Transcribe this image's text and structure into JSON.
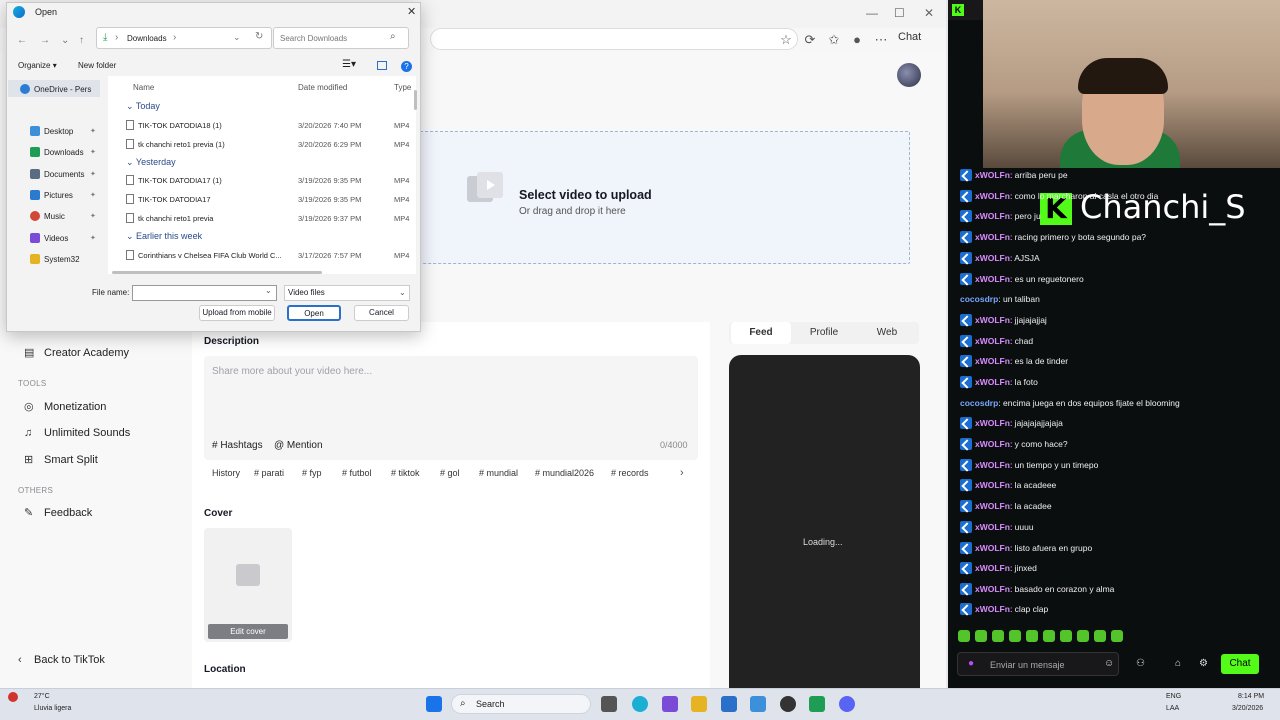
{
  "browser": {
    "win_controls": [
      "—",
      "☐",
      "✕"
    ],
    "chat_label": "Chat",
    "icons": [
      "star-icon",
      "reading-icon",
      "favorites-icon",
      "profile-icon",
      "more-icon"
    ]
  },
  "dialog": {
    "title": "Open",
    "breadcrumb": "Downloads",
    "search_placeholder": "Search Downloads",
    "organize": "Organize",
    "new_folder": "New folder",
    "nav_items": [
      {
        "label": "OneDrive - Pers",
        "color": "#2b7cd3"
      },
      {
        "label": "Desktop",
        "color": "#3c8fd9"
      },
      {
        "label": "Downloads",
        "color": "#1f9d55"
      },
      {
        "label": "Documents",
        "color": "#5a6b84"
      },
      {
        "label": "Pictures",
        "color": "#2a7bd0"
      },
      {
        "label": "Music",
        "color": "#d14836"
      },
      {
        "label": "Videos",
        "color": "#7b4ad6"
      },
      {
        "label": "System32",
        "color": "#e6b422"
      }
    ],
    "columns": {
      "name": "Name",
      "date": "Date modified",
      "type": "Type"
    },
    "groups": [
      {
        "label": "Today",
        "files": [
          {
            "name": "TIK-TOK DATODIA18 (1)",
            "date": "3/20/2026 7:40 PM",
            "type": "MP4"
          },
          {
            "name": "tk chanchi reto1 previa (1)",
            "date": "3/20/2026 6:29 PM",
            "type": "MP4"
          }
        ]
      },
      {
        "label": "Yesterday",
        "files": [
          {
            "name": "TIK-TOK DATODIA17 (1)",
            "date": "3/19/2026 9:35 PM",
            "type": "MP4"
          },
          {
            "name": "TIK-TOK DATODIA17",
            "date": "3/19/2026 9:35 PM",
            "type": "MP4"
          },
          {
            "name": "tk chanchi reto1 previa",
            "date": "3/19/2026 9:37 PM",
            "type": "MP4"
          }
        ]
      },
      {
        "label": "Earlier this week",
        "files": [
          {
            "name": "Corinthians v Chelsea  FIFA Club World C...",
            "date": "3/17/2026 7:57 PM",
            "type": "MP4"
          }
        ]
      }
    ],
    "file_name_label": "File name:",
    "file_name_value": "",
    "file_type": "Video files",
    "upload_mobile": "Upload from mobile",
    "open": "Open",
    "cancel": "Cancel"
  },
  "tiktok": {
    "upload_title": "Select video to upload",
    "upload_sub": "Or drag and drop it here",
    "sidebar": {
      "creator_academy": "Creator Academy",
      "tools_head": "TOOLS",
      "tools": [
        "Monetization",
        "Unlimited Sounds",
        "Smart Split"
      ],
      "others_head": "OTHERS",
      "feedback": "Feedback",
      "back": "Back to TikTok"
    },
    "description_label": "Description",
    "description_placeholder": "Share more about your video here...",
    "hashtags": "# Hashtags",
    "mention": "@ Mention",
    "char_count": "0/4000",
    "history": "History",
    "tags": [
      "# parati",
      "# fyp",
      "# futbol",
      "# tiktok",
      "# gol",
      "# mundial",
      "# mundial2026",
      "# records"
    ],
    "cover_label": "Cover",
    "edit_cover": "Edit cover",
    "location_label": "Location",
    "preview_tabs": [
      "Feed",
      "Profile",
      "Web"
    ],
    "loading": "Loading..."
  },
  "kick": {
    "streamer_overlay": "Chanchi_S",
    "messages": [
      {
        "user": "xWOLFn",
        "color": "#d98cff",
        "badge": true,
        "text": ": arriba peru pe"
      },
      {
        "user": "xWOLFn",
        "color": "#d98cff",
        "badge": true,
        "text": ": como lo marcharon al casla el otro dia"
      },
      {
        "user": "xWOLFn",
        "color": "#d98cff",
        "badge": true,
        "text": ": pero ju"
      },
      {
        "user": "xWOLFn",
        "color": "#d98cff",
        "badge": true,
        "text": ": racing primero y bota segundo pa?"
      },
      {
        "user": "xWOLFn",
        "color": "#d98cff",
        "badge": true,
        "text": ": AJSJA"
      },
      {
        "user": "xWOLFn",
        "color": "#d98cff",
        "badge": true,
        "text": ": es un reguetonero"
      },
      {
        "user": "cocosdrp",
        "color": "#7aa7ff",
        "badge": false,
        "text": ": un taliban"
      },
      {
        "user": "xWOLFn",
        "color": "#d98cff",
        "badge": true,
        "text": ": jjajajajjaj"
      },
      {
        "user": "xWOLFn",
        "color": "#d98cff",
        "badge": true,
        "text": ": chad"
      },
      {
        "user": "xWOLFn",
        "color": "#d98cff",
        "badge": true,
        "text": ": es la de tinder"
      },
      {
        "user": "xWOLFn",
        "color": "#d98cff",
        "badge": true,
        "text": ": la foto"
      },
      {
        "user": "cocosdrp",
        "color": "#7aa7ff",
        "badge": false,
        "text": ": encima juega en dos equipos fijate el blooming"
      },
      {
        "user": "xWOLFn",
        "color": "#d98cff",
        "badge": true,
        "text": ": jajajajajjajaja"
      },
      {
        "user": "xWOLFn",
        "color": "#d98cff",
        "badge": true,
        "text": ": y como hace?"
      },
      {
        "user": "xWOLFn",
        "color": "#d98cff",
        "badge": true,
        "text": ": un tiempo y un timepo"
      },
      {
        "user": "xWOLFn",
        "color": "#d98cff",
        "badge": true,
        "text": ": la acadeee"
      },
      {
        "user": "xWOLFn",
        "color": "#d98cff",
        "badge": true,
        "text": ": la acadee"
      },
      {
        "user": "xWOLFn",
        "color": "#d98cff",
        "badge": true,
        "text": ": uuuu"
      },
      {
        "user": "xWOLFn",
        "color": "#d98cff",
        "badge": true,
        "text": ": listo afuera en grupo"
      },
      {
        "user": "xWOLFn",
        "color": "#d98cff",
        "badge": true,
        "text": ": jinxed"
      },
      {
        "user": "xWOLFn",
        "color": "#d98cff",
        "badge": true,
        "text": ": basado en corazon y alma"
      },
      {
        "user": "xWOLFn",
        "color": "#d98cff",
        "badge": true,
        "text": ": clap clap"
      }
    ],
    "input_placeholder": "Enviar un mensaje",
    "chat_button": "Chat",
    "accent": "#53fc18"
  },
  "taskbar": {
    "weather_temp": "27°C",
    "weather_desc": "Lluvia ligera",
    "search": "Search",
    "lang1": "ENG",
    "lang2": "LAA",
    "time": "8:14 PM",
    "date": "3/20/2026"
  }
}
